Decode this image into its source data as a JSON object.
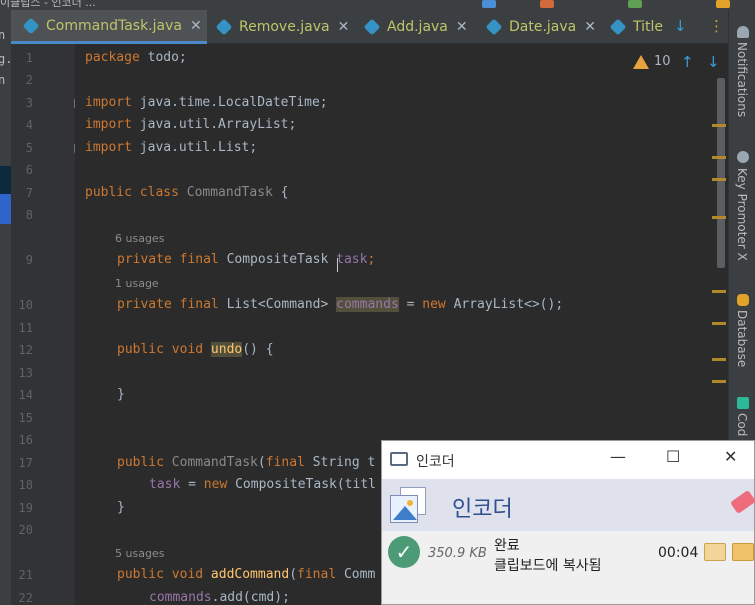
{
  "top_strip": {
    "text": "이클립스 - 인코더 ..."
  },
  "left_strip": {
    "chars": [
      "n",
      "g.",
      "n"
    ]
  },
  "tabs": [
    {
      "label": "CommandTask.java",
      "active": true
    },
    {
      "label": "Remove.java",
      "active": false
    },
    {
      "label": "Add.java",
      "active": false
    },
    {
      "label": "Date.java",
      "active": false
    },
    {
      "label": "Title",
      "active": false
    }
  ],
  "tab_controls": {
    "more_down": "↓",
    "more_menu": "⋮"
  },
  "editor": {
    "warnings_count": "10",
    "line_numbers": [
      "1",
      "2",
      "3",
      "4",
      "5",
      "6",
      "7",
      "8",
      "9",
      "10",
      "11",
      "12",
      "13",
      "14",
      "15",
      "16",
      "17",
      "18",
      "19",
      "20",
      "21",
      "22"
    ],
    "hints": {
      "task_usages": "6 usages",
      "commands_usages": "1 usage",
      "addCommand_usages": "5 usages"
    },
    "code": {
      "l1_kw": "package",
      "l1_rest": " todo;",
      "l3_kw": "import",
      "l3_rest": " java.time.LocalDateTime;",
      "l4_kw": "import",
      "l4_rest": " java.util.ArrayList;",
      "l5_kw": "import",
      "l5_rest": " java.util.List;",
      "l7_kw": "public class",
      "l7_name": " CommandTask",
      "l7_rest": " {",
      "l9_kw": "private final",
      "l9_type": " CompositeTask",
      "l9_field": " task",
      "l9_semi": ";",
      "l10_kw": "private final",
      "l10_type": " List<Command>",
      "l10_field": "commands",
      "l10_eq": " = ",
      "l10_new": "new",
      "l10_rest": " ArrayList<>();",
      "l12_kw": "public void",
      "l12_name": "undo",
      "l12_rest": "() {",
      "l14_rest": "}",
      "l17_kw": "public",
      "l17_name": " CommandTask",
      "l17_paren": "(",
      "l17_final": "final",
      "l17_rest": " String t",
      "l18_field": "task",
      "l18_eq": " = ",
      "l18_new": "new",
      "l18_rest": " CompositeTask(titl",
      "l19_rest": "}",
      "l21_kw": "public void",
      "l21_name": " addCommand",
      "l21_paren": "(",
      "l21_final": "final",
      "l21_rest": " Comm",
      "l22_field": "commands",
      "l22_rest": ".add(cmd);"
    }
  },
  "right_tools": [
    "Notifications",
    "Key Promoter X",
    "Database",
    "Cod"
  ],
  "popup": {
    "window_title": "인코더",
    "app_name": "인코더",
    "file_size": "350.9 KB",
    "status": "완료",
    "message": "클립보드에 복사됨",
    "time": "00:04",
    "window_buttons": {
      "minimize": "—",
      "maximize": "☐",
      "close": "✕"
    }
  },
  "colors": {
    "accent": "#4a88c7",
    "keyword": "#cc7832",
    "string": "#bfc46a",
    "field": "#9876aa",
    "method": "#ffc66d",
    "warning": "#e8a33e"
  }
}
